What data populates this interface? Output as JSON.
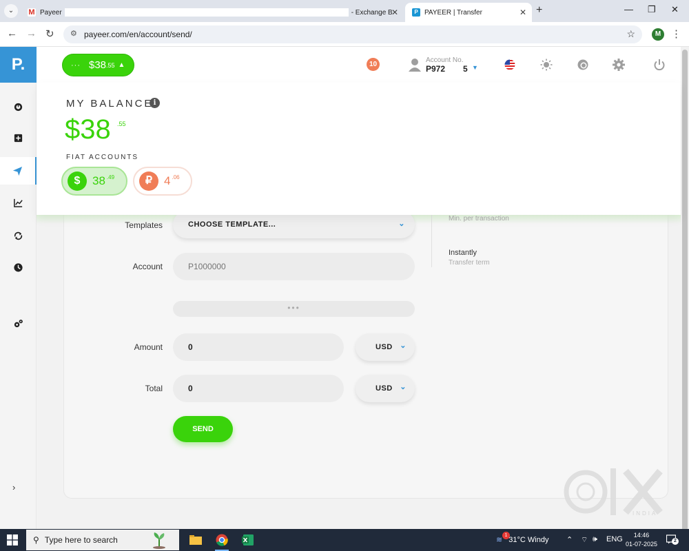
{
  "browser": {
    "tabs": [
      {
        "title_left": "Payeer",
        "title_right": "- Exchange B"
      },
      {
        "title": "PAYEER | Transfer"
      }
    ],
    "url": "payeer.com/en/account/send/",
    "profile_initial": "M"
  },
  "header": {
    "balance_pill": {
      "dots": "···",
      "amount": "$38",
      "cents": ".55"
    },
    "notification_count": "10",
    "account_label": "Account No.",
    "account_number": "P972",
    "account_number_tail": "5"
  },
  "sidebar": {
    "logo": "P.",
    "items": [
      {
        "icon": "dashboard-icon"
      },
      {
        "icon": "add-funds-icon"
      },
      {
        "icon": "send-icon",
        "active": true
      },
      {
        "icon": "stats-icon"
      },
      {
        "icon": "exchange-icon"
      },
      {
        "icon": "history-icon"
      },
      {
        "icon": "settings-gears-icon"
      }
    ],
    "expand": "›"
  },
  "balance_dropdown": {
    "title": "MY BALANCE",
    "amount": "$38",
    "cents": ".55",
    "fiat_title": "FIAT ACCOUNTS",
    "fiat": [
      {
        "symbol": "$",
        "amount": "38",
        "cents": ".49"
      },
      {
        "symbol": "₽",
        "amount": "4",
        "cents": ".06"
      }
    ]
  },
  "form": {
    "templates_label": "Templates",
    "template_value": "CHOOSE TEMPLATE...",
    "account_label": "Account",
    "account_placeholder": "P1000000",
    "sub_bar": "•••",
    "amount_label": "Amount",
    "amount_value": "0",
    "amount_currency": "USD",
    "total_label": "Total",
    "total_value": "0",
    "total_currency": "USD",
    "send_label": "SEND"
  },
  "info": {
    "min_label": "Min. per transaction",
    "term_value": "Instantly",
    "term_label": "Transfer term"
  },
  "watermark": {
    "sub": "INDIA"
  },
  "taskbar": {
    "search_placeholder": "Type here to search",
    "weather": "31°C  Windy",
    "weather_badge": "1",
    "lang": "ENG",
    "time": "14:46",
    "date": "01-07-2025",
    "notif_count": "2"
  },
  "colors": {
    "green": "#3ad30b",
    "blue": "#3694d6",
    "orange": "#f07d57"
  }
}
